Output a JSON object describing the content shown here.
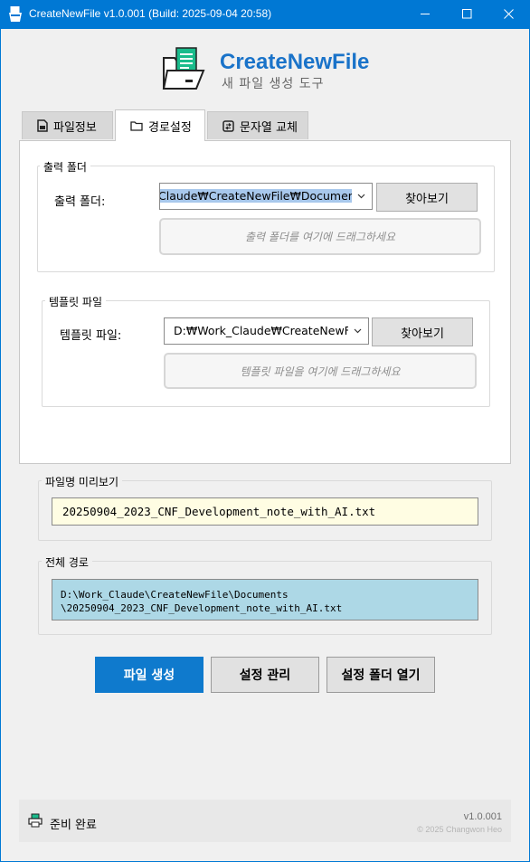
{
  "window": {
    "title": "CreateNewFile v1.0.001 (Build: 2025-09-04 20:58)",
    "accent_color": "#0078d4",
    "controls": [
      "minimize-icon",
      "maximize-icon",
      "close-icon"
    ]
  },
  "header": {
    "app_name": "CreateNewFile",
    "subtitle": "새 파일 생성 도구",
    "app_name_color": "#1a73c9"
  },
  "tabs": [
    {
      "label": "파일정보",
      "icon": "file-icon",
      "active": false
    },
    {
      "label": "경로설정",
      "icon": "folder-icon",
      "active": true
    },
    {
      "label": "문자열 교체",
      "icon": "replace-icon",
      "active": false
    }
  ],
  "output_folder": {
    "group_title": "출력 폴더",
    "label": "출력 폴더:",
    "value": "Claude₩CreateNewFile₩Documents",
    "browse_label": "찾아보기",
    "drop_hint": "출력 폴더를 여기에 드래그하세요"
  },
  "template_file": {
    "group_title": "템플릿 파일",
    "label": "템플릿 파일:",
    "value": "D:₩Work_Claude₩CreateNewFile₩",
    "browse_label": "찾아보기",
    "drop_hint": "템플릿 파일을 여기에 드래그하세요"
  },
  "filename_preview": {
    "title": "파일명 미리보기",
    "value": "20250904_2023_CNF_Development_note_with_AI.txt",
    "background": "#fffde3"
  },
  "full_path": {
    "title": "전체 경로",
    "line1": "D:\\Work_Claude\\CreateNewFile\\Documents",
    "line2": "\\20250904_2023_CNF_Development_note_with_AI.txt",
    "background": "#add8e6"
  },
  "actions": {
    "create": "파일 생성",
    "manage_settings": "설정 관리",
    "open_settings_folder": "설정 폴더 열기",
    "primary_color": "#0f7acd"
  },
  "status": {
    "text": "준비 완료",
    "version": "v1.0.001",
    "copyright": "© 2025 Changwon Heo"
  }
}
